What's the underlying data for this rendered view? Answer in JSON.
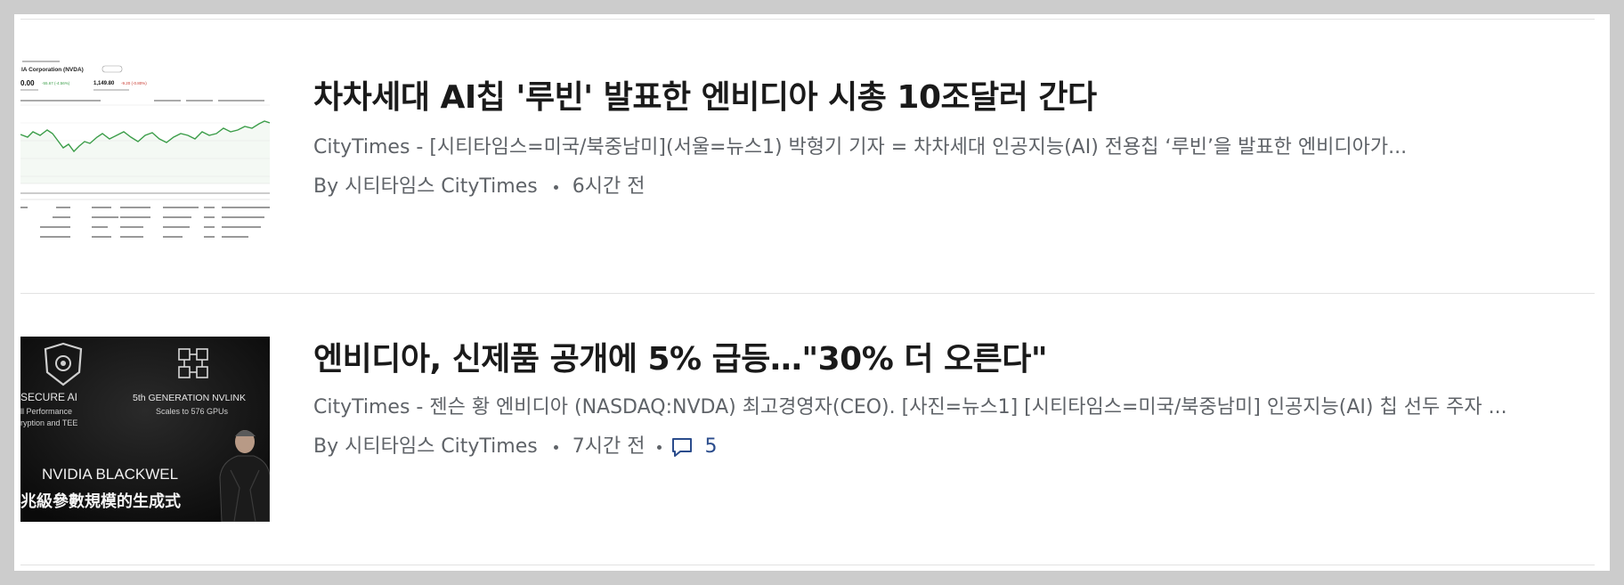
{
  "articles": [
    {
      "title": "차차세대 AI칩 '루빈' 발표한 엔비디아 시총 10조달러 간다",
      "summary": "CityTimes - [시티타임스=미국/북중남미](서울=뉴스1) 박형기 기자 = 차차세대 인공지능(AI) 전용칩 ‘루빈’을 발표한 엔비디아가...",
      "author": "By 시티타임스 CityTimes",
      "time": "6시간 전",
      "thumbnail": {
        "icon": "stock-chart-thumbnail",
        "company": "IA Corporation (NVDA)",
        "price": "0.00",
        "change": "-55.67 (-4.56%)",
        "after_price": "1,149.80",
        "after_change": "-9.20 (-0.80%)"
      }
    },
    {
      "title": "엔비디아, 신제품 공개에 5% 급등…\"30% 더 오른다\"",
      "summary": "CityTimes - 젠슨 황 엔비디아 (NASDAQ:NVDA) 최고경영자(CEO). [사진=뉴스1] [시티타임스=미국/북중남미] 인공지능(AI) 칩 선두 주자 ...",
      "author": "By 시티타임스 CityTimes",
      "time": "7시간 전",
      "comment_count": "5",
      "thumbnail": {
        "icon": "nvidia-presentation-photo",
        "left_title": "SECURE AI",
        "left_sub1": "ll Performance",
        "left_sub2": "ryption and TEE",
        "right_title": "5th GENERATION NVLINK",
        "right_sub": "Scales to 576 GPUs",
        "brand": "NVIDIA BLACKWEL",
        "caption": "兆級參數規模的生成式"
      }
    }
  ],
  "colors": {
    "background": "#cccccc",
    "panel": "#ffffff",
    "headline": "#1a1a1a",
    "body_text": "#5f6368",
    "comment_link": "#2b4c8c",
    "chart_green": "#3c9e4a",
    "chart_red": "#c8372d"
  }
}
